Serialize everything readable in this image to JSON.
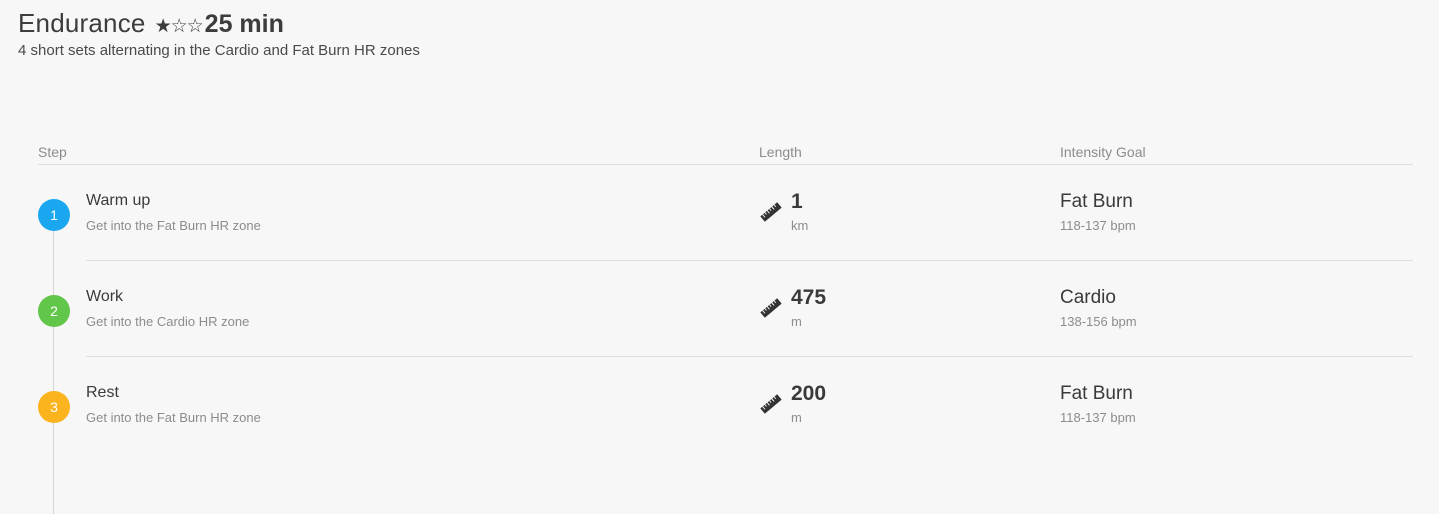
{
  "workout": {
    "title": "Endurance",
    "stars": "★☆☆",
    "duration": "25 min",
    "subtitle": "4 short sets alternating in the Cardio and Fat Burn HR zones"
  },
  "columns": {
    "step": "Step",
    "length": "Length",
    "intensity": "Intensity Goal"
  },
  "steps": [
    {
      "number": "1",
      "name": "Warm up",
      "description": "Get into the Fat Burn HR zone",
      "length_value": "1",
      "length_unit": "km",
      "zone": "Fat Burn",
      "bpm": "118-137 bpm",
      "color": "#1aa7f0"
    },
    {
      "number": "2",
      "name": "Work",
      "description": "Get into the Cardio HR zone",
      "length_value": "475",
      "length_unit": "m",
      "zone": "Cardio",
      "bpm": "138-156 bpm",
      "color": "#62c64a"
    },
    {
      "number": "3",
      "name": "Rest",
      "description": "Get into the Fat Burn HR zone",
      "length_value": "200",
      "length_unit": "m",
      "zone": "Fat Burn",
      "bpm": "118-137 bpm",
      "color": "#fbb31e"
    }
  ],
  "icons": {
    "length": "ruler-icon"
  }
}
